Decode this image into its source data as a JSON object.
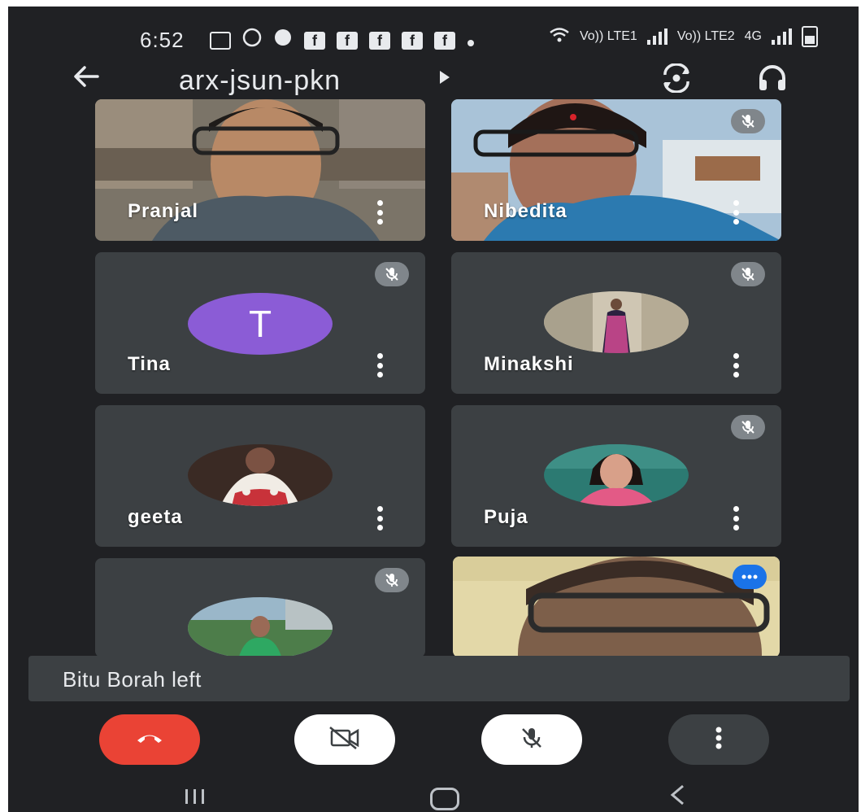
{
  "status_bar": {
    "time": "6:52",
    "network_left": "Vo)) LTE1",
    "network_right": "Vo)) LTE2",
    "network_type": "4G"
  },
  "top_bar": {
    "meeting_code": "arx-jsun-pkn"
  },
  "participants": [
    {
      "name": "Pranjal",
      "muted": false,
      "type": "video"
    },
    {
      "name": "Nibedita",
      "muted": true,
      "type": "video"
    },
    {
      "name": "Tina",
      "muted": true,
      "type": "letter",
      "initial": "T"
    },
    {
      "name": "Minakshi",
      "muted": true,
      "type": "photo"
    },
    {
      "name": "geeta",
      "muted": false,
      "type": "photo"
    },
    {
      "name": "Puja",
      "muted": true,
      "type": "photo"
    },
    {
      "name": "",
      "muted": true,
      "type": "photo"
    },
    {
      "name": "",
      "muted": false,
      "type": "video",
      "speaking": true
    }
  ],
  "toast": {
    "message": "Bitu Borah left"
  },
  "controls": {
    "colors": {
      "end_call": "#ea4335",
      "camera": "#ffffff",
      "mic": "#ffffff",
      "more": "#3c4043"
    }
  },
  "icons": [
    "back-arrow-icon",
    "switch-camera-icon",
    "headphones-icon",
    "mic-off-icon",
    "more-vert-icon",
    "end-call-icon",
    "camera-off-icon"
  ]
}
